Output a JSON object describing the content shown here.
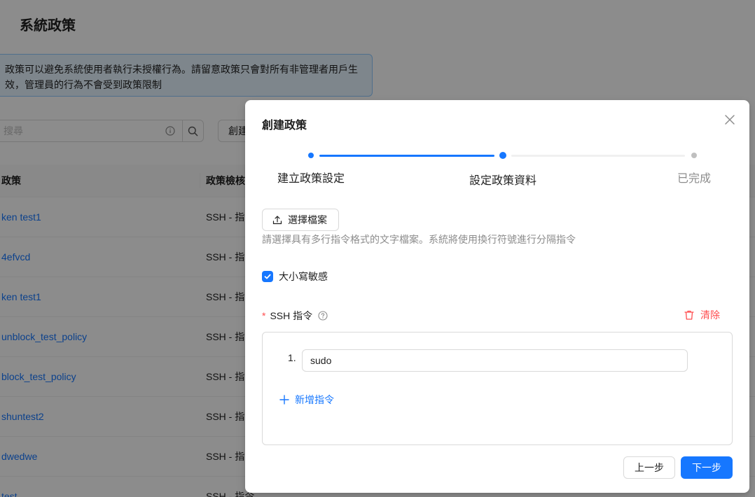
{
  "page": {
    "title": "系統政策",
    "info": "政策可以避免系統使用者執行未授權行為。請留意政策只會對所有非管理者用戶生效，管理員的行為不會受到政策限制",
    "search_placeholder": "搜尋",
    "create_label": "創建",
    "columns": [
      "政策",
      "政策檢核"
    ],
    "rows": [
      {
        "name": "ken test1",
        "check": "SSH - 指"
      },
      {
        "name": "4efvcd",
        "check": "SSH - 指"
      },
      {
        "name": "ken test1",
        "check": "SSH - 指"
      },
      {
        "name": "unblock_test_policy",
        "check": "SSH - 指"
      },
      {
        "name": "block_test_policy",
        "check": "SSH - 指"
      },
      {
        "name": "shuntest2",
        "check": "SSH - 指"
      },
      {
        "name": "dwedwe",
        "check": "SSH - 指"
      },
      {
        "name": "test",
        "check": "SSH - 指令"
      }
    ]
  },
  "modal": {
    "title": "創建政策",
    "steps": [
      {
        "label": "建立政策設定",
        "status": "finish"
      },
      {
        "label": "設定政策資料",
        "status": "process"
      },
      {
        "label": "已完成",
        "status": "wait"
      }
    ],
    "upload_label": "選擇檔案",
    "hint": "請選擇具有多行指令格式的文字檔案。系統將使用換行符號進行分隔指令",
    "case_sensitive_label": "大小寫敏感",
    "case_sensitive_checked": true,
    "field_label": "SSH 指令",
    "required_mark": "*",
    "clear_label": "清除",
    "commands": [
      {
        "index": "1.",
        "value": "sudo"
      }
    ],
    "add_command_label": "新增指令",
    "prev_label": "上一步",
    "next_label": "下一步"
  },
  "colors": {
    "primary": "#1677ff",
    "danger": "#ff4d4f",
    "info_bg": "#e6f4ff",
    "mask": "rgba(0,0,0,0.45)"
  }
}
